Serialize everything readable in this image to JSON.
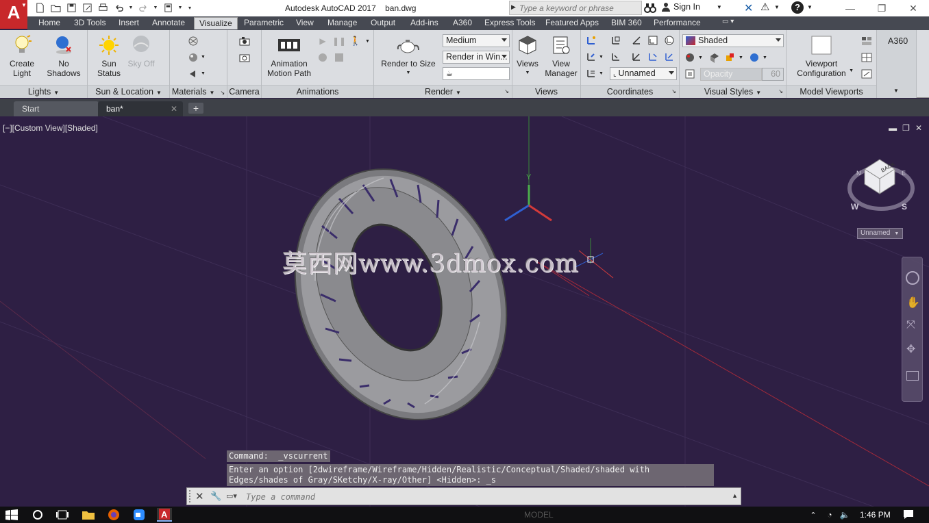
{
  "app": {
    "logo_letter": "A",
    "title": "Autodesk AutoCAD 2017    ban.dwg"
  },
  "search": {
    "placeholder": "Type a keyword or phrase"
  },
  "signin": {
    "label": "Sign In"
  },
  "ribbon_tabs": [
    {
      "label": "Home",
      "active": false
    },
    {
      "label": "3D Tools",
      "active": false
    },
    {
      "label": "Insert",
      "active": false
    },
    {
      "label": "Annotate",
      "active": false
    },
    {
      "label": "Visualize",
      "active": true
    },
    {
      "label": "Parametric",
      "active": false
    },
    {
      "label": "View",
      "active": false
    },
    {
      "label": "Manage",
      "active": false
    },
    {
      "label": "Output",
      "active": false
    },
    {
      "label": "Add-ins",
      "active": false
    },
    {
      "label": "A360",
      "active": false
    },
    {
      "label": "Express Tools",
      "active": false
    },
    {
      "label": "Featured Apps",
      "active": false
    },
    {
      "label": "BIM 360",
      "active": false
    },
    {
      "label": "Performance",
      "active": false
    }
  ],
  "panels": {
    "lights": {
      "title": "Lights",
      "create_light": "Create\nLight",
      "no_shadows": "No\nShadows"
    },
    "sun": {
      "title": "Sun & Location",
      "sun_status": "Sun\nStatus",
      "sky_off": "Sky Off"
    },
    "materials": {
      "title": "Materials"
    },
    "camera": {
      "title": "Camera"
    },
    "animations": {
      "title": "Animations",
      "motion_path": "Animation\nMotion Path"
    },
    "render": {
      "title": "Render",
      "render_to_size": "Render to Size",
      "quality": "Medium",
      "target": "Render in Win..."
    },
    "views": {
      "title": "Views",
      "views_btn": "Views",
      "view_manager": "View\nManager"
    },
    "coordinates": {
      "title": "Coordinates",
      "ucs_name": "Unnamed"
    },
    "visual_styles": {
      "title": "Visual Styles",
      "style": "Shaded",
      "opacity_label": "Opacity",
      "opacity_value": "60"
    },
    "model_viewports": {
      "title": "Model Viewports",
      "viewport_config": "Viewport\nConfiguration"
    },
    "a360": {
      "title": "A360"
    }
  },
  "doc_tabs": [
    {
      "label": "Start",
      "active": false
    },
    {
      "label": "ban*",
      "active": true
    }
  ],
  "viewport": {
    "label": "[−][Custom View][Shaded]",
    "watermark": "莫西网www.3dmox.com",
    "viewcube_face": "BACK",
    "viewcube_w": "W",
    "viewcube_s": "S",
    "viewcube_n": "N",
    "viewcube_e": "E",
    "ucs_axis_y": "Y",
    "viewcube_name": "Unnamed"
  },
  "command": {
    "history_1": "Command:  _vscurrent",
    "history_2": "Enter an option [2dwireframe/Wireframe/Hidden/Realistic/Conceptual/Shaded/shaded with Edges/shades of Gray/SKetchy/X-ray/Other] <Hidden>: _s",
    "placeholder": "Type a command"
  },
  "statusbar": {
    "model": "MODEL",
    "time": "1:46 PM"
  },
  "colors": {
    "accent_red": "#c8282b",
    "viewport_bg": "#2e1f44",
    "ribbon_bg": "#dbdde1",
    "tabbar_bg": "#464952"
  }
}
